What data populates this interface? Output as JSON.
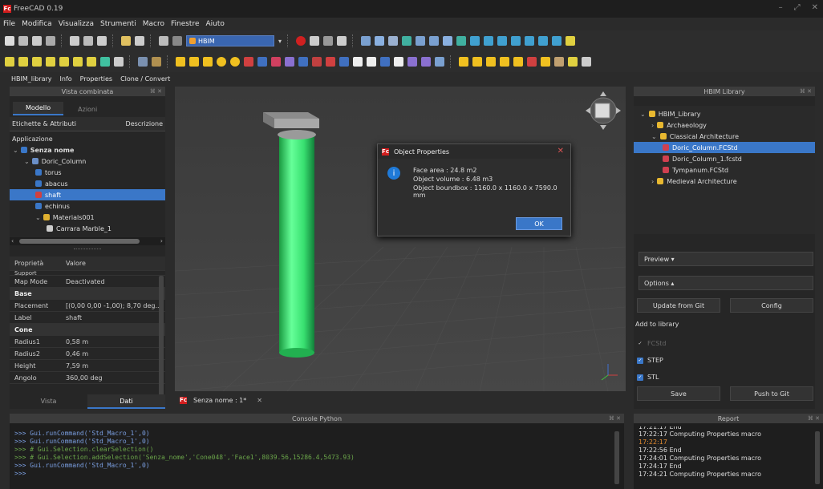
{
  "window": {
    "title": "FreeCAD 0.19",
    "controls": [
      "–",
      "⤢",
      "✕"
    ]
  },
  "menu": [
    "File",
    "Modifica",
    "Visualizza",
    "Strumenti",
    "Macro",
    "Finestre",
    "Aiuto"
  ],
  "workbench": {
    "selected": "HBIM"
  },
  "tabs3": [
    "HBIM_library",
    "Info",
    "Properties",
    "Clone / Convert"
  ],
  "left": {
    "title": "Vista combinata",
    "tabs": [
      "Modello",
      "Azioni"
    ],
    "tree_header": {
      "col1": "Etichette & Attributi",
      "col2": "Descrizione"
    },
    "tree_section": "Applicazione",
    "tree": [
      {
        "label": "Senza nome",
        "indent": 0,
        "color": "#3a77c8",
        "bold": true
      },
      {
        "label": "Doric_Column",
        "indent": 1,
        "color": "#6a8fc8"
      },
      {
        "label": "torus",
        "indent": 2,
        "color": "#3a77c8"
      },
      {
        "label": "abacus",
        "indent": 2,
        "color": "#3a77c8"
      },
      {
        "label": "shaft",
        "indent": 2,
        "color": "#d04040",
        "selected": true
      },
      {
        "label": "echinus",
        "indent": 2,
        "color": "#3a77c8"
      },
      {
        "label": "Materials001",
        "indent": 2,
        "color": "#e0b030"
      },
      {
        "label": "Carrara Marble_1",
        "indent": 3,
        "color": "#cccccc"
      }
    ],
    "prop_header": {
      "col1": "Proprietà",
      "col2": "Valore"
    },
    "props": [
      {
        "k": "Support",
        "v": "",
        "partial": true
      },
      {
        "k": "Map Mode",
        "v": "Deactivated"
      },
      {
        "k": "Base",
        "v": "",
        "group": true
      },
      {
        "k": "Placement",
        "v": "[(0,00 0,00 -1,00); 8,70 deg..."
      },
      {
        "k": "Label",
        "v": "shaft"
      },
      {
        "k": "Cone",
        "v": "",
        "group": true
      },
      {
        "k": "Radius1",
        "v": "0,58 m"
      },
      {
        "k": "Radius2",
        "v": "0,46 m"
      },
      {
        "k": "Height",
        "v": "7,59 m"
      },
      {
        "k": "Angolo",
        "v": "360,00 deg"
      }
    ],
    "bottom_tabs": [
      "Vista",
      "Dati"
    ]
  },
  "doc_tab": "Senza nome : 1*",
  "dialog": {
    "title": "Object Properties",
    "lines": [
      "Face area : 24.8 m2",
      "Object volume : 6.48 m3",
      "Object boundbox : 1160.0 x 1160.0 x 7590.0 mm"
    ],
    "ok": "OK"
  },
  "right": {
    "title": "HBIM Library",
    "tree": [
      {
        "label": "HBIM_Library",
        "indent": 0,
        "type": "folder"
      },
      {
        "label": "Archaeology",
        "indent": 1,
        "type": "folder"
      },
      {
        "label": "Classical Architecture",
        "indent": 1,
        "type": "folder"
      },
      {
        "label": "Doric_Column.FCStd",
        "indent": 2,
        "type": "file",
        "selected": true
      },
      {
        "label": "Doric_Column_1.fcstd",
        "indent": 2,
        "type": "file"
      },
      {
        "label": "Tympanum.FCStd",
        "indent": 2,
        "type": "file"
      },
      {
        "label": "Medieval Architecture",
        "indent": 1,
        "type": "folder"
      }
    ],
    "preview": "Preview ▾",
    "options": "Options ▴",
    "update": "Update from Git",
    "config": "Config",
    "add_label": "Add to library",
    "checks": [
      {
        "label": "FCStd",
        "checked": true,
        "disabled": true
      },
      {
        "label": "STEP",
        "checked": true
      },
      {
        "label": "STL",
        "checked": true
      }
    ],
    "save": "Save",
    "push": "Push to Git"
  },
  "console": {
    "title": "Console Python",
    "lines": [
      ">>> Gui.runCommand('Std_Macro_1',0)",
      ">>> Gui.runCommand('Std_Macro_1',0)",
      ">>> # Gui.Selection.clearSelection()",
      ">>> # Gui.Selection.addSelection('Senza_nome','Cone048','Face1',8039.56,15286.4,5473.93)",
      ">>> Gui.runCommand('Std_Macro_1',0)",
      ">>>"
    ]
  },
  "report": {
    "title": "Report",
    "lines": [
      {
        "t": "17:21:17 End",
        "c": "#dddddd"
      },
      {
        "t": "17:22:17  Computing Properties macro",
        "c": "#dddddd"
      },
      {
        "t": "17:22:17",
        "c": "#e08a30"
      },
      {
        "t": "17:22:56  End",
        "c": "#dddddd"
      },
      {
        "t": "17:24:01  Computing Properties macro",
        "c": "#dddddd"
      },
      {
        "t": "17:24:17  End",
        "c": "#dddddd"
      },
      {
        "t": "17:24:21  Computing Properties macro",
        "c": "#dddddd"
      }
    ]
  },
  "colors": {
    "accent": "#3a77c8",
    "shaft_green": "#38e070",
    "dialog_icon": "#1f7ad8"
  }
}
